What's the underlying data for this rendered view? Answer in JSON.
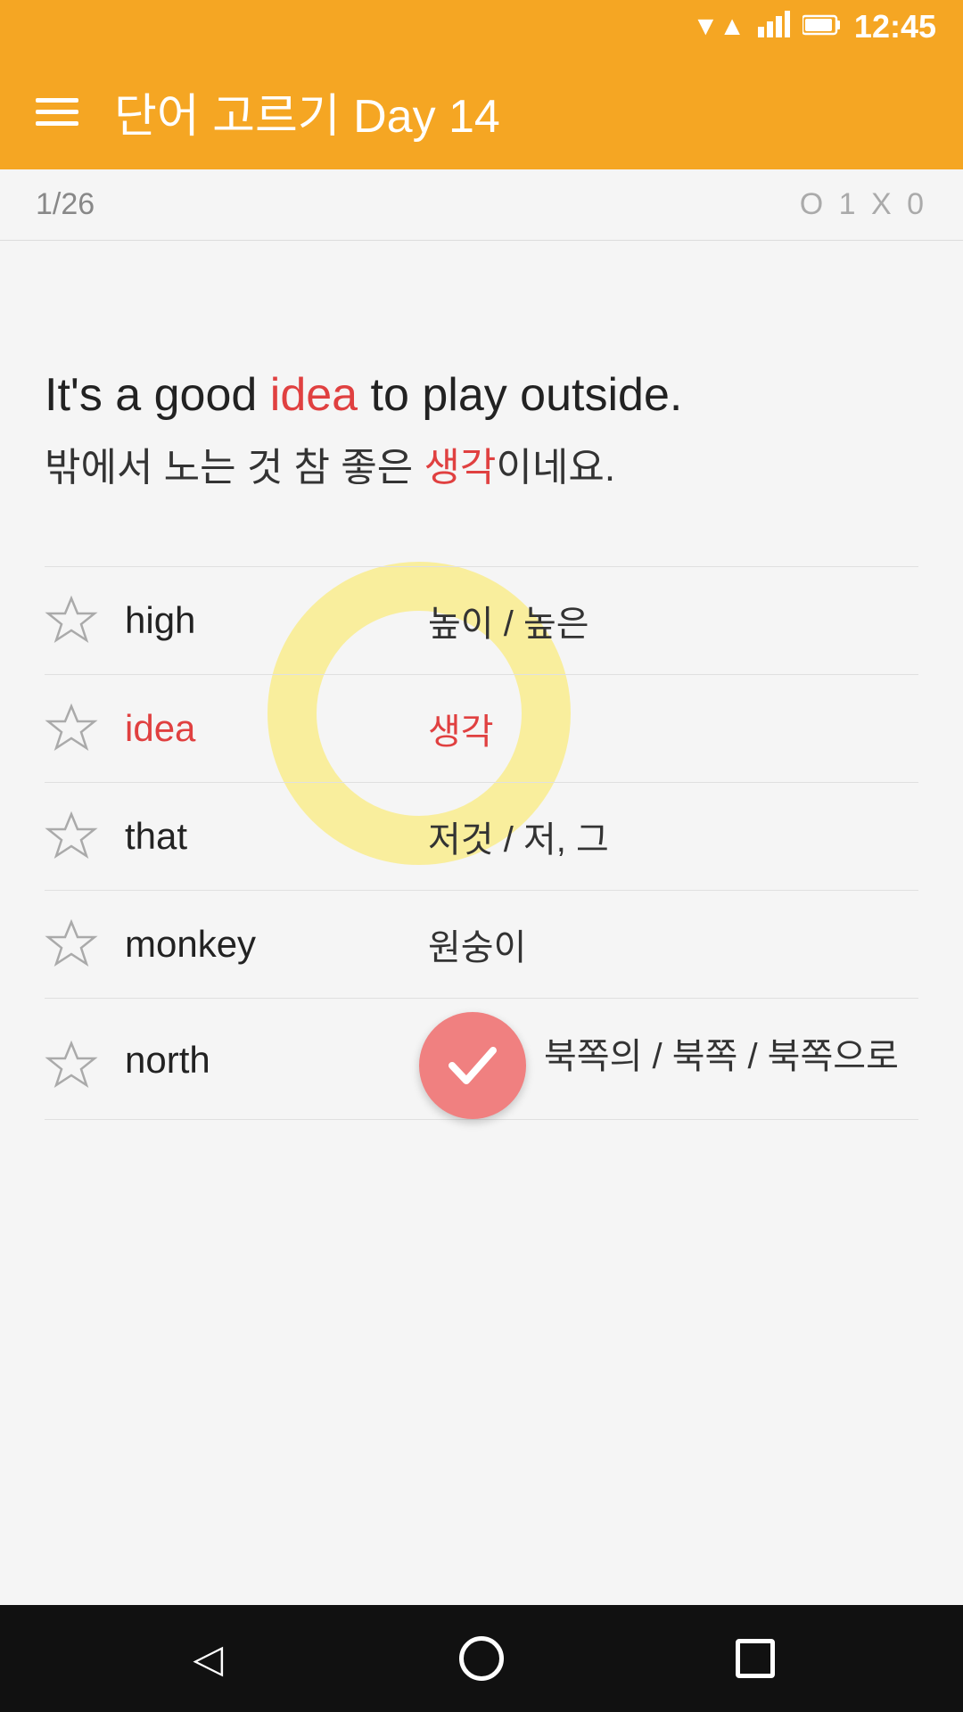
{
  "statusBar": {
    "time": "12:45"
  },
  "appBar": {
    "title": "단어 고르기  Day 14",
    "menuIcon": "hamburger-icon"
  },
  "scoreBar": {
    "progress": "1/26",
    "score": "O 1  X 0"
  },
  "sentence": {
    "english": "It's a good ",
    "englishHighlight": "idea",
    "englishSuffix": " to play outside.",
    "korean": "밖에서 노는 것 참 좋은 ",
    "koreanHighlight": "생각",
    "koreanSuffix": "이네요."
  },
  "words": [
    {
      "id": 1,
      "english": "high",
      "korean": "높이 / 높은",
      "highlighted": false,
      "checked": false
    },
    {
      "id": 2,
      "english": "idea",
      "korean": "생각",
      "highlighted": true,
      "checked": false
    },
    {
      "id": 3,
      "english": "that",
      "korean": "저것 / 저, 그",
      "highlighted": false,
      "checked": false
    },
    {
      "id": 4,
      "english": "monkey",
      "korean": "원숭이",
      "highlighted": false,
      "checked": false
    },
    {
      "id": 5,
      "english": "north",
      "korean": "북쪽의 / 북쪽 / 북쪽으로",
      "highlighted": false,
      "checked": true
    }
  ],
  "navBar": {
    "backLabel": "◁",
    "homeLabel": "○",
    "recentLabel": "□"
  }
}
